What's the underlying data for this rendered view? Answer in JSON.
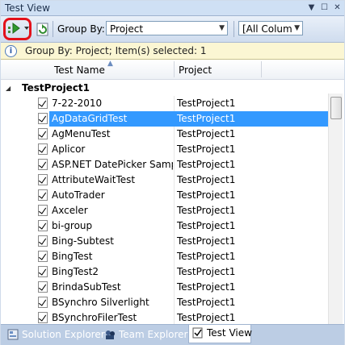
{
  "window": {
    "title": "Test View"
  },
  "toolbar": {
    "group_by_label": "Group By:",
    "group_by_value": "Project",
    "columns_value": "[All Columns]"
  },
  "infobar": {
    "text": "Group By: Project; Item(s) selected: 1"
  },
  "grid": {
    "columns": [
      "Test Name",
      "Project"
    ],
    "group": {
      "name": "TestProject1"
    },
    "rows": [
      {
        "name": "7-22-2010",
        "project": "TestProject1"
      },
      {
        "name": "AgDataGridTest",
        "project": "TestProject1"
      },
      {
        "name": "AgMenuTest",
        "project": "TestProject1"
      },
      {
        "name": "Aplicor",
        "project": "TestProject1"
      },
      {
        "name": "ASP.NET DatePicker Sample",
        "project": "TestProject1"
      },
      {
        "name": "AttributeWaitTest",
        "project": "TestProject1"
      },
      {
        "name": "AutoTrader",
        "project": "TestProject1"
      },
      {
        "name": "Axceler",
        "project": "TestProject1"
      },
      {
        "name": "bi-group",
        "project": "TestProject1"
      },
      {
        "name": "Bing-Subtest",
        "project": "TestProject1"
      },
      {
        "name": "BingTest",
        "project": "TestProject1"
      },
      {
        "name": "BingTest2",
        "project": "TestProject1"
      },
      {
        "name": "BrindaSubTest",
        "project": "TestProject1"
      },
      {
        "name": "BSynchro Silverlight",
        "project": "TestProject1"
      },
      {
        "name": "BSynchroFilerTest",
        "project": "TestProject1"
      }
    ],
    "selected_index": 1
  },
  "tabs": [
    {
      "label": "Solution Explorer",
      "icon": "solution-explorer-icon"
    },
    {
      "label": "Team Explorer",
      "icon": "team-explorer-icon"
    },
    {
      "label": "Test View",
      "icon": "test-view-icon"
    }
  ],
  "colors": {
    "selection": "#3399ff",
    "highlight_ring": "#e3111b",
    "info_bg": "#fbf6d3"
  }
}
